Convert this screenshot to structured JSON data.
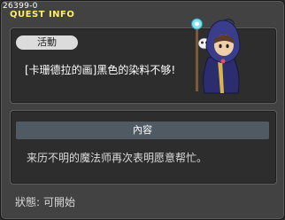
{
  "window": {
    "quest_id": "26399-0",
    "title": "QUEST INFO"
  },
  "quest": {
    "category_badge": "活動",
    "name": "[卡珊德拉的画]黑色的染料不够!"
  },
  "content": {
    "header": "內容",
    "description": "来历不明的魔法师再次表明愿意帮忙。"
  },
  "status": {
    "label": "狀態:",
    "value": "可開始"
  },
  "colors": {
    "title_yellow": "#ffee66",
    "panel_bg": "#2d2d2d",
    "header_bg": "#4f5a63",
    "badge_bg": "#dcdcdc"
  }
}
